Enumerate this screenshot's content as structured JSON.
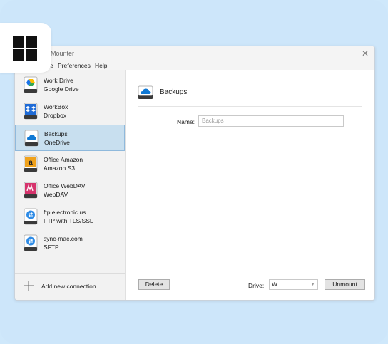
{
  "window": {
    "title": "Mounter",
    "close_glyph": "✕"
  },
  "menu": {
    "items": [
      "File",
      "Preferences",
      "Help"
    ]
  },
  "sidebar": {
    "connections": [
      {
        "name": "Work Drive",
        "service": "Google Drive",
        "icon": "google-drive-icon",
        "selected": false
      },
      {
        "name": "WorkBox",
        "service": "Dropbox",
        "icon": "dropbox-icon",
        "selected": false
      },
      {
        "name": "Backups",
        "service": "OneDrive",
        "icon": "onedrive-icon",
        "selected": true
      },
      {
        "name": "Office Amazon",
        "service": "Amazon S3",
        "icon": "amazon-s3-icon",
        "selected": false
      },
      {
        "name": "Office WebDAV",
        "service": "WebDAV",
        "icon": "webdav-icon",
        "selected": false
      },
      {
        "name": "ftp.electronic.us",
        "service": "FTP with TLS/SSL",
        "icon": "ftp-icon",
        "selected": false
      },
      {
        "name": "sync-mac.com",
        "service": "SFTP",
        "icon": "sftp-icon",
        "selected": false
      }
    ],
    "add_label": "Add new connection"
  },
  "detail": {
    "title": "Backups",
    "name_label": "Name:",
    "name_value": "Backups",
    "delete_label": "Delete",
    "drive_label": "Drive:",
    "drive_value": "W",
    "unmount_label": "Unmount"
  },
  "colors": {
    "background": "#cde6fa",
    "selected_row": "#c8dfef",
    "selected_border": "#8fb9dc"
  }
}
